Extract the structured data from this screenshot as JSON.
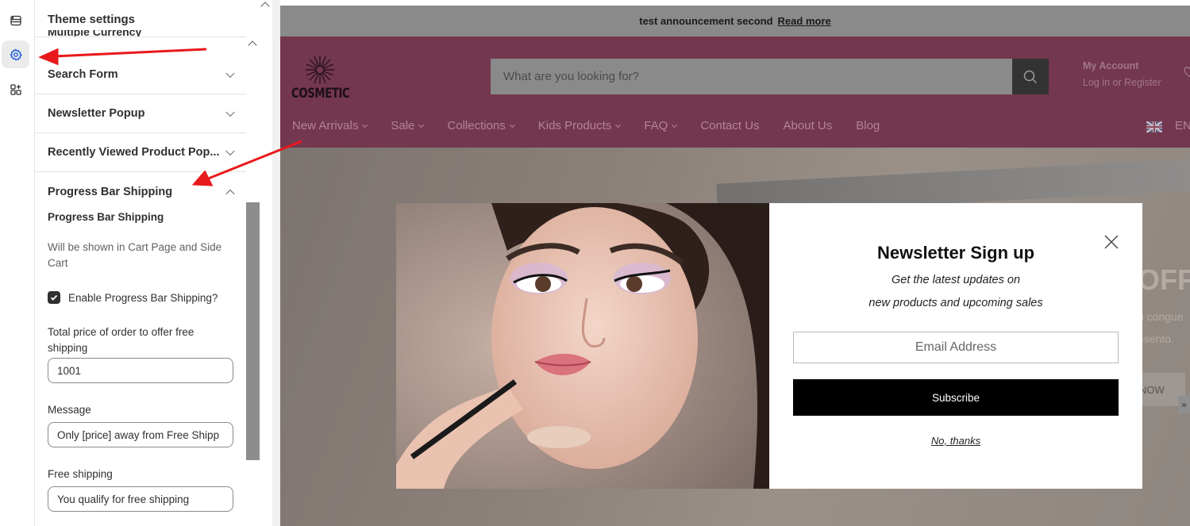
{
  "rail": {
    "items": [
      {
        "icon": "sections-icon"
      },
      {
        "icon": "settings-gear-icon",
        "active": true
      },
      {
        "icon": "apps-icon"
      }
    ]
  },
  "panel": {
    "title": "Theme settings",
    "cut_section": "Multiple Currency",
    "sections": [
      {
        "label": "Search Form",
        "expanded": false
      },
      {
        "label": "Newsletter Popup",
        "expanded": false
      },
      {
        "label": "Recently Viewed Product Pop...",
        "expanded": false
      },
      {
        "label": "Progress Bar Shipping",
        "expanded": true
      }
    ],
    "progress_bar": {
      "heading": "Progress Bar Shipping",
      "help": "Will be shown in Cart Page and Side Cart",
      "enable_label": "Enable Progress Bar Shipping?",
      "enable_checked": true,
      "total_label": "Total price of order to offer free shipping",
      "total_value": "1001",
      "message_label": "Message",
      "message_value": "Only [price] away from Free Shipp",
      "free_label": "Free shipping",
      "free_value": "You qualify for free shipping"
    }
  },
  "store": {
    "announcement": "test announcement second",
    "announcement_link": "Read more",
    "logo_text": "COSMETIC",
    "search_placeholder": "What are you looking for?",
    "account_title": "My Account",
    "account_sub": "Log in or Register",
    "nav": [
      {
        "label": "New Arrivals",
        "dropdown": true
      },
      {
        "label": "Sale",
        "dropdown": true
      },
      {
        "label": "Collections",
        "dropdown": true
      },
      {
        "label": "Kids Products",
        "dropdown": true
      },
      {
        "label": "FAQ",
        "dropdown": true
      },
      {
        "label": "Contact Us",
        "dropdown": false
      },
      {
        "label": "About Us",
        "dropdown": false
      },
      {
        "label": "Blog",
        "dropdown": false
      }
    ],
    "language": "EN",
    "hero_off": "OFF",
    "hero_text1": "o congue",
    "hero_text2": "esento.",
    "hero_button": "NOW",
    "hero_arrow": "»"
  },
  "modal": {
    "title": "Newsletter Sign up",
    "subtitle_line1": "Get the latest updates on",
    "subtitle_line2": "new products and upcoming sales",
    "email_placeholder": "Email Address",
    "subscribe_label": "Subscribe",
    "decline_label": "No, thanks"
  },
  "colors": {
    "header_bg": "#73374f",
    "annotation_arrow": "#e8191c",
    "subscribe_bg": "#000000"
  }
}
